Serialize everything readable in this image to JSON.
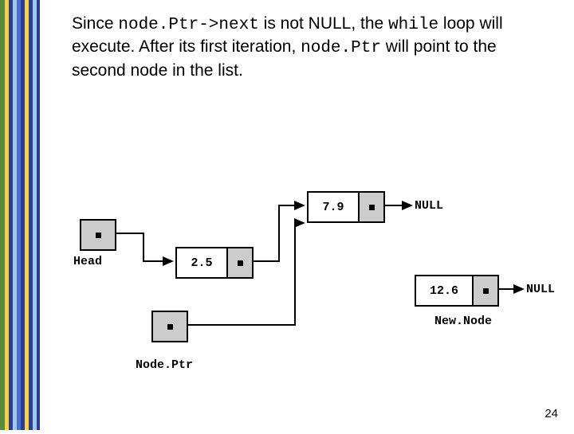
{
  "text": {
    "line_part1": "Since ",
    "code1": "node.Ptr->next",
    "line_part2": " is not NULL, the ",
    "code2": "while",
    "line_part3": " loop will execute. After its first iteration, ",
    "code3": "node.Ptr",
    "line_part4": " will point to the second node in the list."
  },
  "diagram": {
    "head_label": "Head",
    "nodeptr_label": "Node.Ptr",
    "newnode_label": "New.Node",
    "null1": "NULL",
    "null2": "NULL",
    "node1_value": "2.5",
    "node2_value": "7.9",
    "node3_value": "12.6"
  },
  "pagenum": "24",
  "chart_data": {
    "type": "diagram",
    "structure": "singly-linked-list-insertion",
    "nodes": [
      {
        "id": "head",
        "kind": "pointer",
        "label": "Head",
        "points_to": "n1"
      },
      {
        "id": "nodeptr",
        "kind": "pointer",
        "label": "Node.Ptr",
        "points_to": "n2"
      },
      {
        "id": "n1",
        "kind": "list-node",
        "value": 2.5,
        "next": "n2"
      },
      {
        "id": "n2",
        "kind": "list-node",
        "value": 7.9,
        "next": "NULL"
      },
      {
        "id": "newnode",
        "kind": "pointer-label",
        "label": "New.Node",
        "refers_to": "n3"
      },
      {
        "id": "n3",
        "kind": "list-node",
        "value": 12.6,
        "next": "NULL"
      }
    ]
  }
}
